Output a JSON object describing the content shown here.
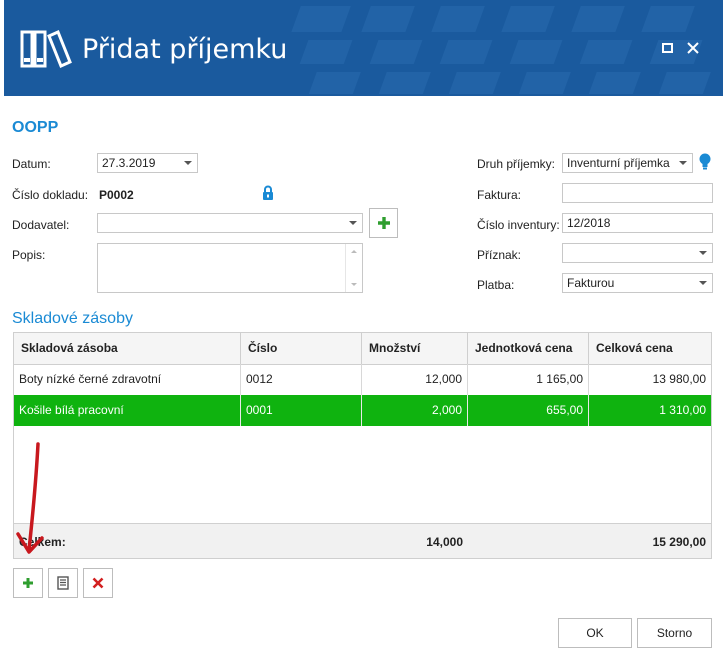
{
  "window": {
    "title": "Přidat příjemku",
    "maximize_icon": "maximize-icon",
    "close_icon": "close-icon"
  },
  "colors": {
    "titlebar": "#1a5a9e",
    "accent": "#1a8ad4",
    "selected_row": "#0fb30f",
    "add_green": "#2f9e2f",
    "delete_red": "#d22020",
    "annotation_arrow": "#c8181e"
  },
  "form": {
    "section": "OOPP",
    "datum": {
      "label": "Datum:",
      "value": "27.3.2019"
    },
    "cislo_dokladu": {
      "label": "Číslo dokladu:",
      "value": "P0002",
      "icon": "lock-icon"
    },
    "dodavatel": {
      "label": "Dodavatel:",
      "value": "",
      "add_icon": "plus-icon"
    },
    "popis": {
      "label": "Popis:",
      "value": ""
    },
    "druh_prijemky": {
      "label": "Druh příjemky:",
      "value": "Inventurní příjemka",
      "icon": "lightbulb-icon"
    },
    "faktura": {
      "label": "Faktura:",
      "value": ""
    },
    "cislo_inventury": {
      "label": "Číslo inventury:",
      "value": "12/2018"
    },
    "priznak": {
      "label": "Příznak:",
      "value": ""
    },
    "platba": {
      "label": "Platba:",
      "value": "Fakturou"
    }
  },
  "stock": {
    "title": "Skladové zásoby",
    "columns": [
      "Skladová zásoba",
      "Číslo",
      "Množství",
      "Jednotková cena",
      "Celková cena"
    ],
    "rows": [
      {
        "name": "Boty nízké černé zdravotní",
        "cislo": "0012",
        "mnozstvi": "12,000",
        "jednotkova": "1 165,00",
        "celkova": "13 980,00",
        "selected": false
      },
      {
        "name": "Košile bílá pracovní",
        "cislo": "0001",
        "mnozstvi": "2,000",
        "jednotkova": "655,00",
        "celkova": "1 310,00",
        "selected": true
      }
    ],
    "footer": {
      "label": "Celkem:",
      "mnozstvi": "14,000",
      "celkova": "15 290,00"
    }
  },
  "toolbar": {
    "add_icon": "plus-icon",
    "edit_icon": "document-icon",
    "delete_icon": "delete-icon"
  },
  "buttons": {
    "ok": "OK",
    "cancel": "Storno"
  }
}
